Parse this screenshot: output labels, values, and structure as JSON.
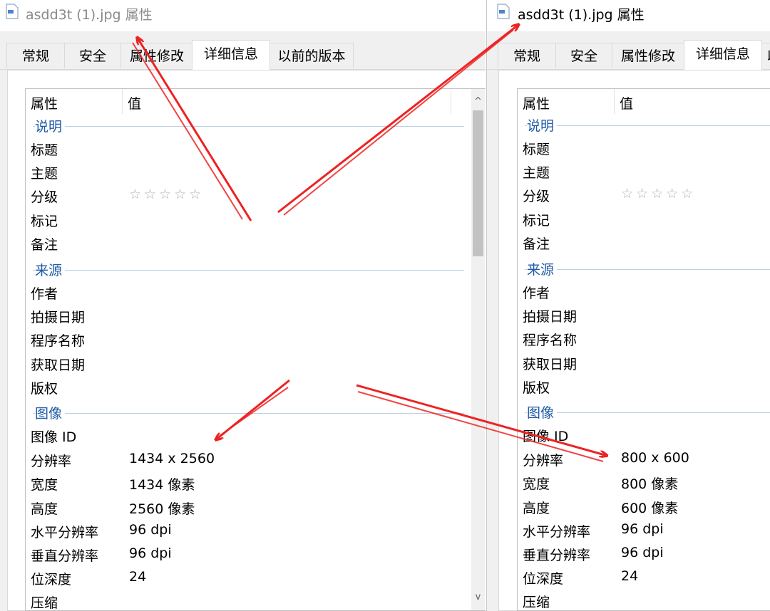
{
  "left_window": {
    "title": "asdd3t (1).jpg 属性",
    "tabs": [
      "常规",
      "安全",
      "属性修改",
      "详细信息",
      "以前的版本"
    ],
    "active_tab": "详细信息",
    "columns": {
      "property": "属性",
      "value": "值"
    },
    "groups": {
      "description": "说明",
      "origin": "来源",
      "image": "图像"
    },
    "rows": {
      "title": {
        "label": "标题",
        "value": ""
      },
      "subject": {
        "label": "主题",
        "value": ""
      },
      "rating": {
        "label": "分级",
        "value": "☆☆☆☆☆"
      },
      "tags": {
        "label": "标记",
        "value": ""
      },
      "comments": {
        "label": "备注",
        "value": ""
      },
      "author": {
        "label": "作者",
        "value": ""
      },
      "date_taken": {
        "label": "拍摄日期",
        "value": ""
      },
      "program": {
        "label": "程序名称",
        "value": ""
      },
      "date_acquired": {
        "label": "获取日期",
        "value": ""
      },
      "copyright": {
        "label": "版权",
        "value": ""
      },
      "image_id": {
        "label": "图像 ID",
        "value": ""
      },
      "dimensions": {
        "label": "分辨率",
        "value": "1434 x 2560"
      },
      "width": {
        "label": "宽度",
        "value": "1434 像素"
      },
      "height": {
        "label": "高度",
        "value": "2560 像素"
      },
      "h_res": {
        "label": "水平分辨率",
        "value": "96 dpi"
      },
      "v_res": {
        "label": "垂直分辨率",
        "value": "96 dpi"
      },
      "bit_depth": {
        "label": "位深度",
        "value": "24"
      },
      "compression": {
        "label": "压缩",
        "value": ""
      }
    },
    "scrollbar": {
      "up": "^",
      "down": "v"
    }
  },
  "right_window": {
    "title": "asdd3t (1).jpg 属性",
    "tabs": [
      "常规",
      "安全",
      "属性修改",
      "详细信息",
      "以"
    ],
    "active_tab": "详细信息",
    "columns": {
      "property": "属性",
      "value": "值"
    },
    "groups": {
      "description": "说明",
      "origin": "来源",
      "image": "图像"
    },
    "rows": {
      "title": {
        "label": "标题",
        "value": ""
      },
      "subject": {
        "label": "主题",
        "value": ""
      },
      "rating": {
        "label": "分级",
        "value": "☆☆☆☆☆"
      },
      "tags": {
        "label": "标记",
        "value": ""
      },
      "comments": {
        "label": "备注",
        "value": ""
      },
      "author": {
        "label": "作者",
        "value": ""
      },
      "date_taken": {
        "label": "拍摄日期",
        "value": ""
      },
      "program": {
        "label": "程序名称",
        "value": ""
      },
      "date_acquired": {
        "label": "获取日期",
        "value": ""
      },
      "copyright": {
        "label": "版权",
        "value": ""
      },
      "image_id": {
        "label": "图像 ID",
        "value": ""
      },
      "dimensions": {
        "label": "分辨率",
        "value": "800 x 600"
      },
      "width": {
        "label": "宽度",
        "value": "800 像素"
      },
      "height": {
        "label": "高度",
        "value": "600 像素"
      },
      "h_res": {
        "label": "水平分辨率",
        "value": "96 dpi"
      },
      "v_res": {
        "label": "垂直分辨率",
        "value": "96 dpi"
      },
      "bit_depth": {
        "label": "位深度",
        "value": "24"
      },
      "compression": {
        "label": "压缩",
        "value": ""
      }
    }
  },
  "colors": {
    "annotation_arrow": "#ee2222",
    "group_heading": "#1f5aa6",
    "star": "#b0b0b0"
  },
  "icons": {
    "file": "file-image-icon",
    "annotation": "red-arrow-icon"
  }
}
